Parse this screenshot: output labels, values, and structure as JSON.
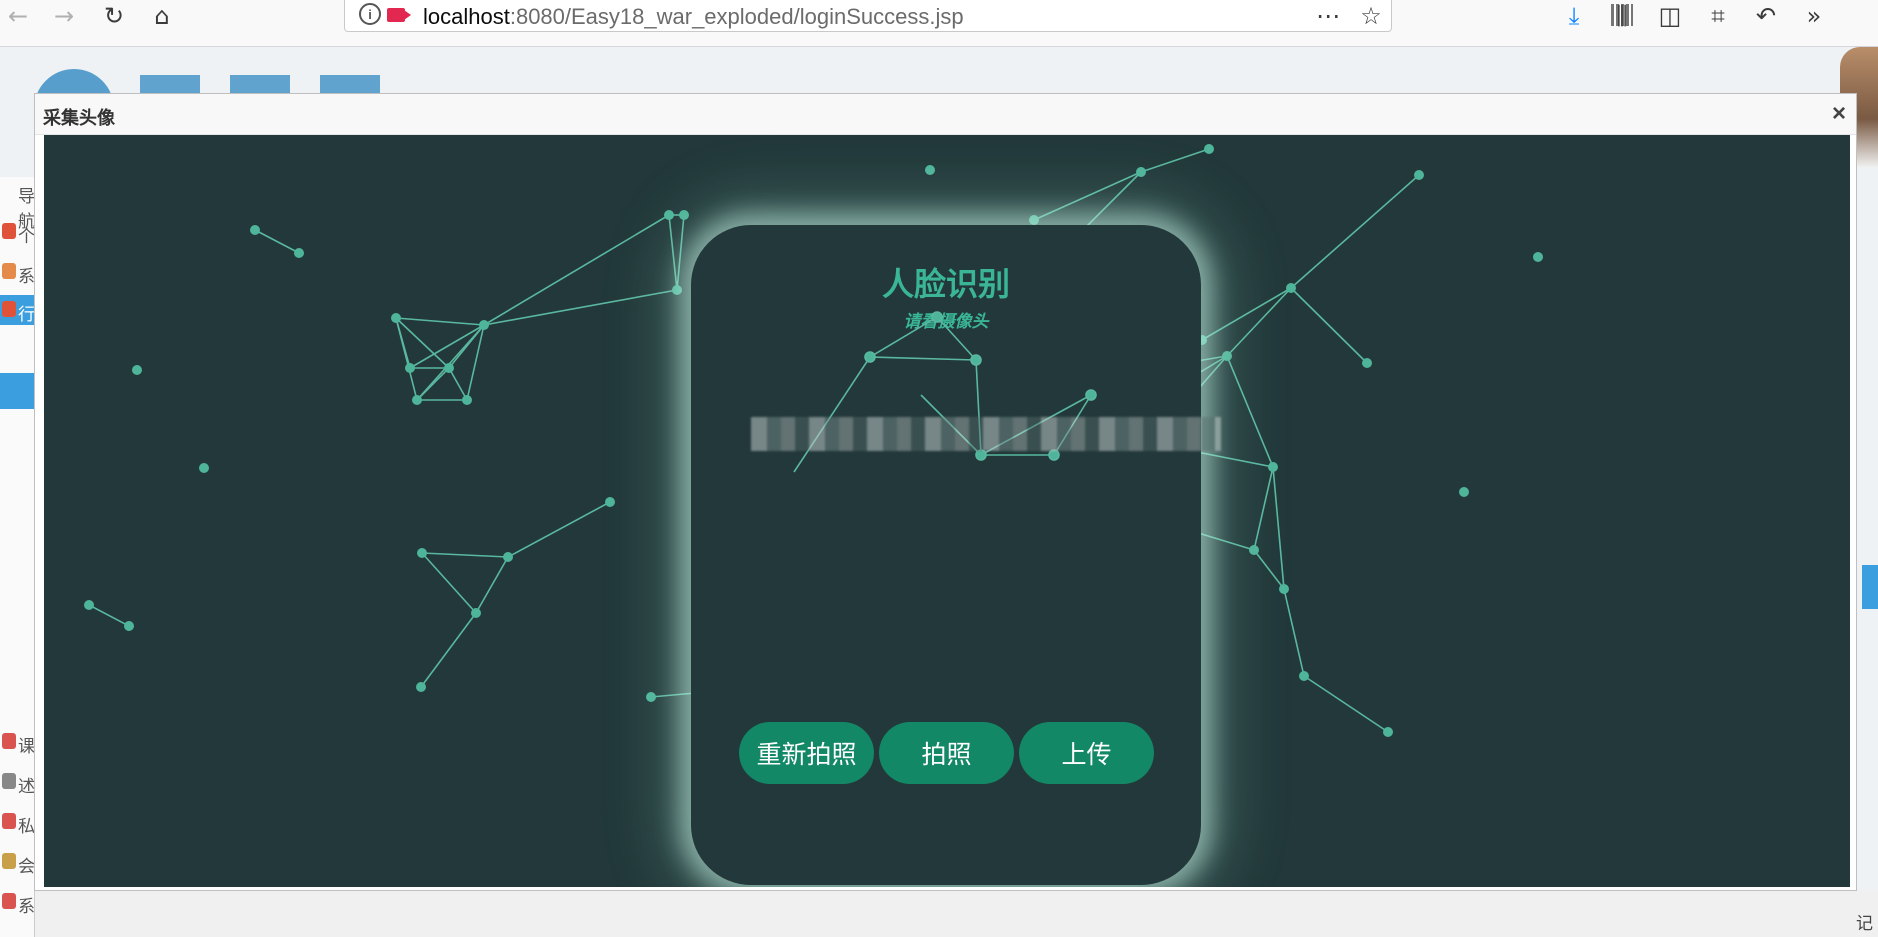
{
  "browser": {
    "url_host": "localhost",
    "url_rest": ":8080/Easy18_war_exploded/loginSuccess.jsp",
    "icons": [
      "back-arrow-icon",
      "forward-arrow-icon",
      "reload-icon",
      "home-icon",
      "site-info-icon",
      "camera-in-use-icon",
      "qr-code-icon",
      "page-actions-icon",
      "bookmark-star-icon",
      "downloads-icon",
      "library-icon",
      "sidebar-icon",
      "crop-screenshot-icon",
      "undo-icon",
      "overflow-chevrons-icon"
    ]
  },
  "background_page": {
    "sidebar_partial_labels": [
      "导航",
      "个",
      "系",
      "行",
      "",
      "",
      "",
      "",
      "",
      "",
      "",
      "",
      "",
      "课",
      "述",
      "私",
      "会",
      "系"
    ],
    "right_partial_label": "记"
  },
  "modal": {
    "title": "采集头像",
    "close_label": "×"
  },
  "face_panel": {
    "title": "人脸识别",
    "subtitle": "请看摄像头"
  },
  "buttons": {
    "retake": "重新拍照",
    "capture": "拍照",
    "upload": "上传"
  },
  "colors": {
    "stage_bg": "#22383a",
    "network_node": "#4fb59a",
    "network_line": "#5ab8a0",
    "accent_text": "#3ab596",
    "button_bg": "#138866"
  }
}
